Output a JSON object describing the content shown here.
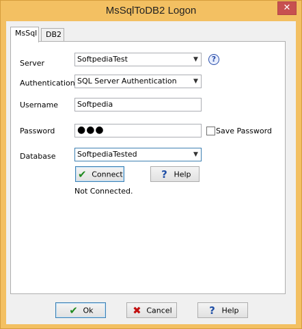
{
  "window": {
    "title": "MsSqlToDB2 Logon",
    "close_glyph": "✕"
  },
  "tabs": [
    {
      "label": "MsSql",
      "active": true
    },
    {
      "label": "DB2",
      "active": false
    }
  ],
  "form": {
    "server": {
      "label": "Server",
      "value": "SoftpediaTest"
    },
    "authentication": {
      "label": "Authentication",
      "value": "SQL Server Authentication"
    },
    "username": {
      "label": "Username",
      "value": "Softpedia"
    },
    "password": {
      "label": "Password",
      "value": "●●●"
    },
    "save_password": {
      "label": "Save Password",
      "checked": false
    },
    "database": {
      "label": "Database",
      "value": "SoftpediaTested"
    },
    "connect_button": {
      "label": "Connect",
      "icon": "check-icon"
    },
    "help_button": {
      "label": "Help",
      "icon": "question-icon"
    },
    "status_text": "Not Connected.",
    "help_icon_glyph": "?"
  },
  "footer": {
    "ok_button": {
      "label": "Ok",
      "icon": "check-icon"
    },
    "cancel_button": {
      "label": "Cancel",
      "icon": "x-icon"
    },
    "help_button": {
      "label": "Help",
      "icon": "question-icon"
    }
  },
  "colors": {
    "frame": "#f3c062",
    "client": "#f0f0f0",
    "close": "#c75050",
    "focus": "#3c7fb1"
  }
}
